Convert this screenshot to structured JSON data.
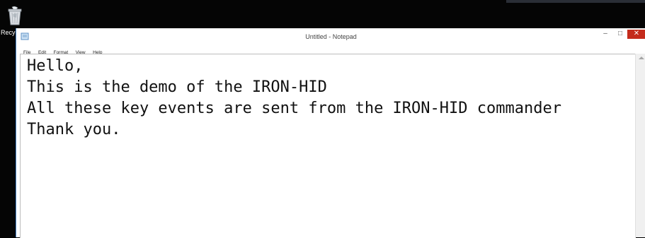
{
  "desktop": {
    "recycle_bin_label": "Recyc"
  },
  "window": {
    "title": "Untitled - Notepad",
    "controls": {
      "minimize": "–",
      "maximize": "□",
      "close": "✕"
    }
  },
  "menu": {
    "items": [
      "File",
      "Edit",
      "Format",
      "View",
      "Help"
    ]
  },
  "editor": {
    "lines": [
      "Hello,",
      "This is the demo of the IRON-HID",
      "All these key events are sent from the IRON-HID commander",
      "Thank you."
    ]
  },
  "colors": {
    "close_button": "#c42b1c",
    "window_border": "#4a86c8"
  }
}
